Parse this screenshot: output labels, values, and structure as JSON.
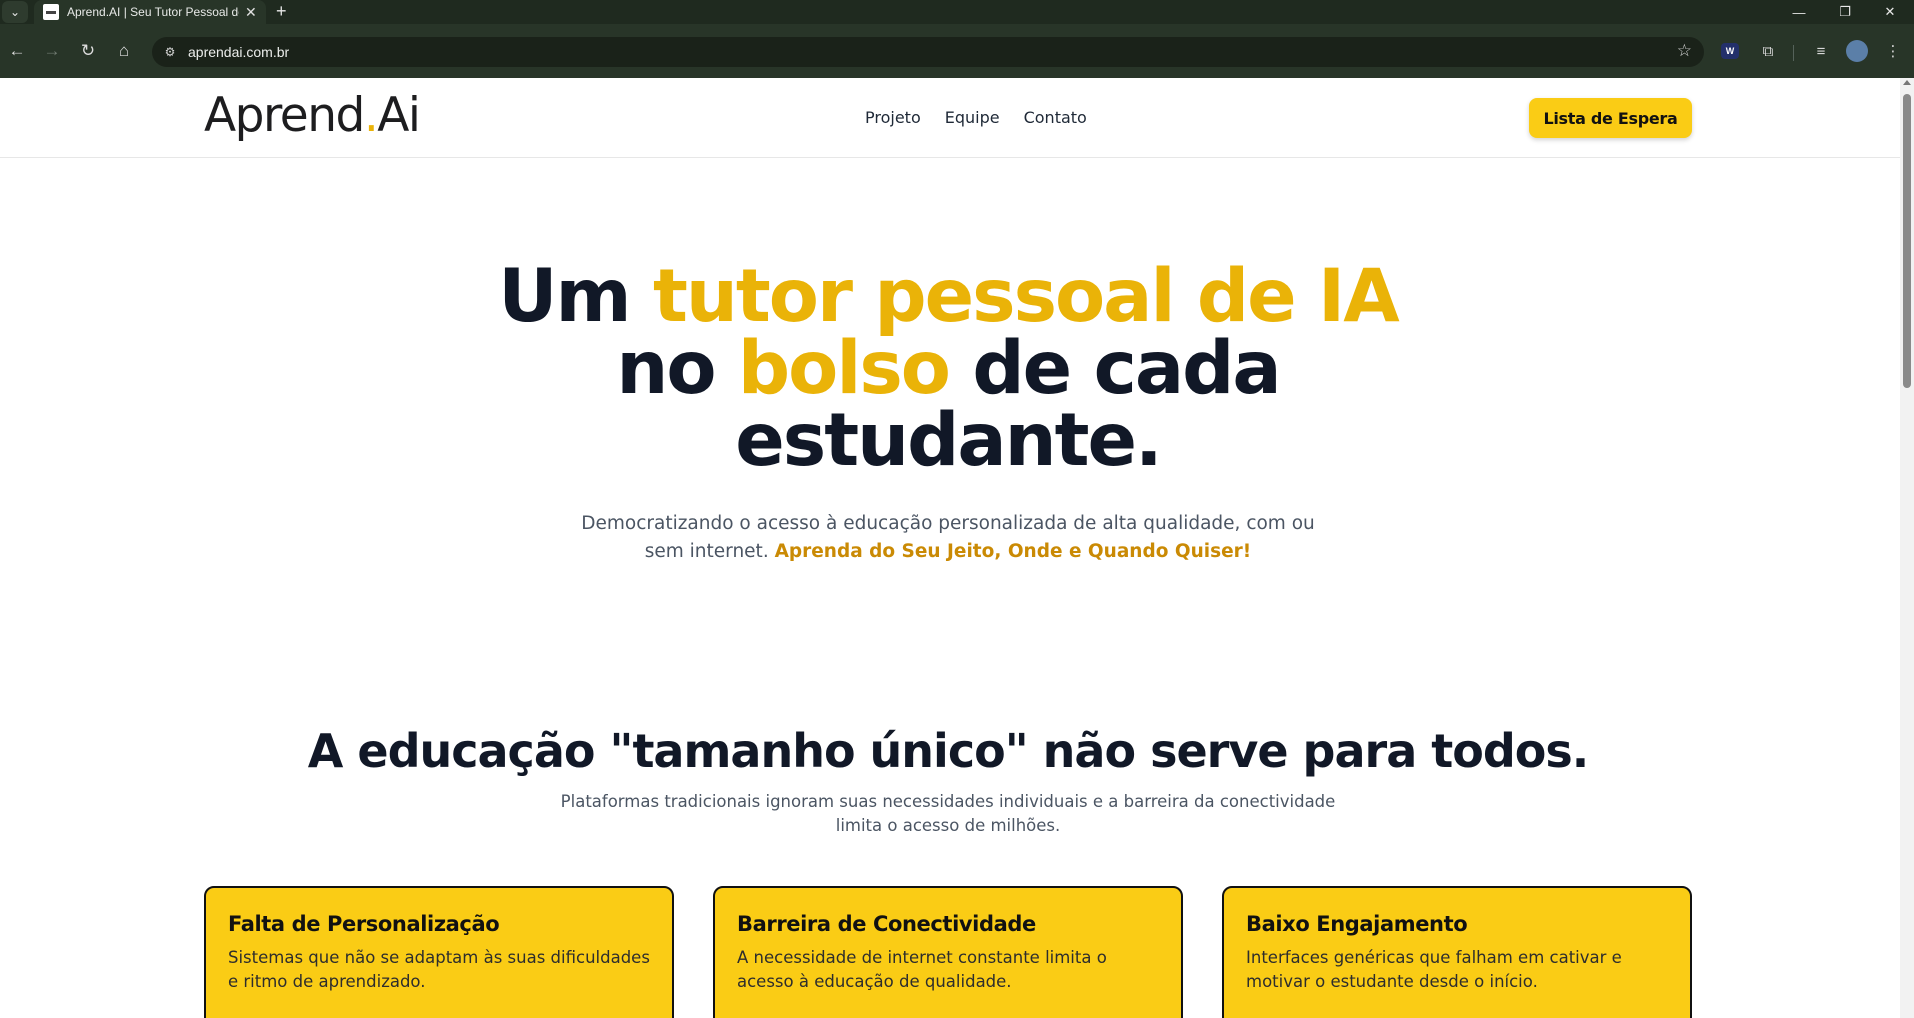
{
  "browser": {
    "tab_title": "Aprend.AI | Seu Tutor Pessoal de IA",
    "url": "aprendai.com.br"
  },
  "header": {
    "logo_main": "Aprend",
    "logo_dot": ".",
    "logo_suffix": "Ai",
    "nav": [
      "Projeto",
      "Equipe",
      "Contato"
    ],
    "cta_label": "Lista de Espera"
  },
  "hero": {
    "title_1": "Um ",
    "title_hl_1": "tutor pessoal de IA",
    "title_2": "no ",
    "title_hl_2": "bolso",
    "title_3": " de cada",
    "title_4": "estudante.",
    "subtitle": "Democratizando o acesso à educação personalizada de alta qualidade, com ou sem internet. ",
    "subtitle_accent": "Aprenda do Seu Jeito, Onde e Quando Quiser!"
  },
  "problem": {
    "title": "A educação \"tamanho único\" não serve para todos.",
    "subtitle": "Plataformas tradicionais ignoram suas necessidades individuais e a barreira da conectividade limita o acesso de milhões.",
    "cards": [
      {
        "title": "Falta de Personalização",
        "text": "Sistemas que não se adaptam às suas dificuldades e ritmo de aprendizado."
      },
      {
        "title": "Barreira de Conectividade",
        "text": "A necessidade de internet constante limita o acesso à educação de qualidade."
      },
      {
        "title": "Baixo Engajamento",
        "text": "Interfaces genéricas que falham em cativar e motivar o estudante desde o início."
      }
    ]
  },
  "colors": {
    "accent": "#facc15",
    "accent_text": "#eab308",
    "dark": "#111827"
  }
}
